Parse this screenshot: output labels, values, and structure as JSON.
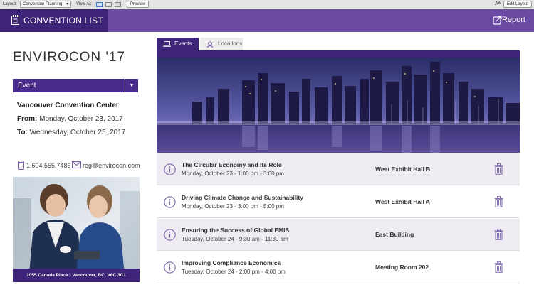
{
  "toolbar": {
    "layout_label": "Layout:",
    "layout_value": "Convention Planning",
    "view_as_label": "View As:",
    "preview_label": "Preview",
    "font_size_icon": "Aᴬ",
    "edit_layout_label": "Edit Layout"
  },
  "header": {
    "title": "CONVENTION LIST",
    "report_label": "Report"
  },
  "convention": {
    "name": "ENVIROCON '17",
    "event_select_value": "Event",
    "venue": "Vancouver Convention Center",
    "from_label": "From:",
    "from_date": "Monday, October 23, 2017",
    "to_label": "To:",
    "to_date": "Wednesday, October 25, 2017",
    "phone": "1.604.555.7486",
    "email": "reg@envirocon.com",
    "address": "1055 Canada Place - Vancouver, BC, V6C 3C1"
  },
  "tabs": [
    {
      "label": "Events",
      "active": true
    },
    {
      "label": "Locations",
      "active": false
    }
  ],
  "events": [
    {
      "title": "The Circular Economy and its Role",
      "time": "Monday, October 23 - 1:00 pm - 3:00 pm",
      "room": "West Exhibit Hall B"
    },
    {
      "title": "Driving Climate Change and Sustainability",
      "time": "Monday, October 23 - 3:00 pm - 5:00 pm",
      "room": "West Exhibit Hall A"
    },
    {
      "title": "Ensuring the Success of Global EMIS",
      "time": "Tuesday, October 24 - 9:30 am - 11:30 am",
      "room": "East Building"
    },
    {
      "title": "Improving Compliance Economics",
      "time": "Tuesday, October 24 - 2:00 pm - 4:00 pm",
      "room": "Meeting Room 202"
    }
  ],
  "colors": {
    "header_bar": "#6b4aa3",
    "header_dark": "#3e2479",
    "accent_purple": "#4a2c8c",
    "row_shade": "#eeebf3",
    "icon_purple": "#7a64a8"
  },
  "icons": {
    "app": "notepad-icon",
    "report": "export-icon",
    "events_tab": "laptop-icon",
    "locations_tab": "location-pin-icon",
    "phone": "phone-icon",
    "email": "envelope-icon",
    "info": "info-circle-icon",
    "delete": "trash-icon"
  }
}
